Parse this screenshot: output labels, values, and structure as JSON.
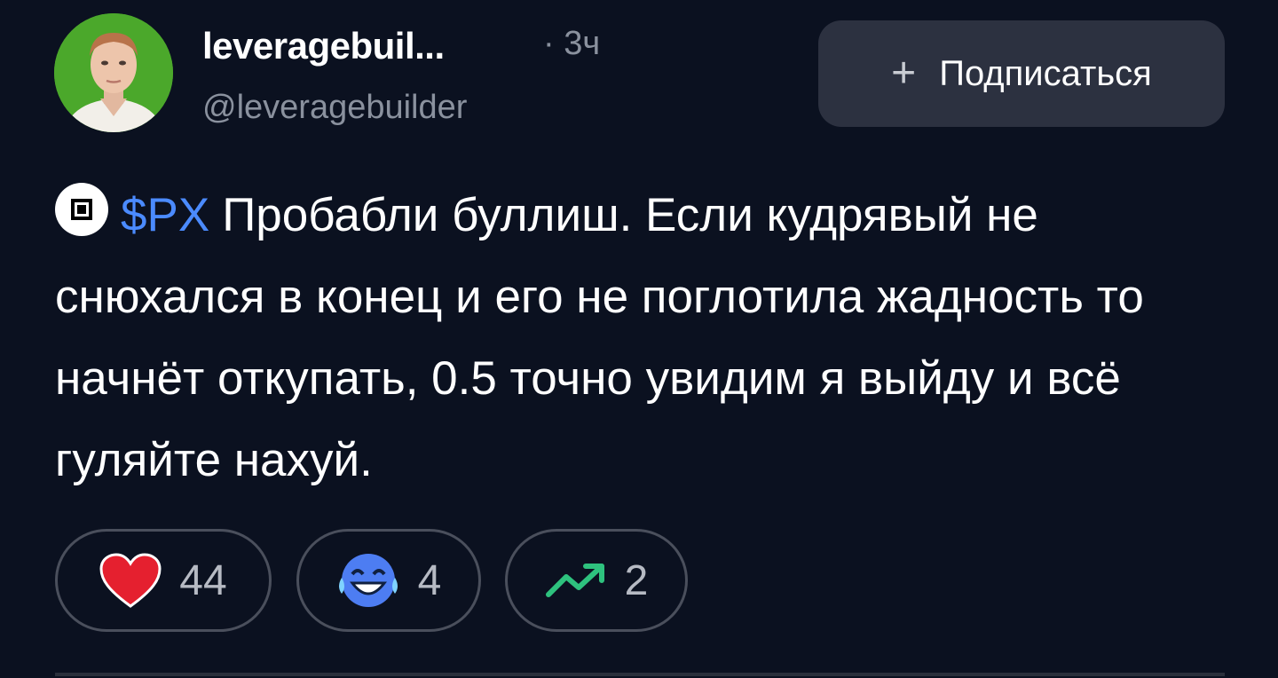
{
  "post": {
    "author": {
      "name": "leveragebuil...",
      "handle": "@leveragebuilder",
      "time": "· 3ч"
    },
    "follow_button": {
      "icon": "plus-icon",
      "label": "Подписаться"
    },
    "ticker": {
      "icon": "square-logo-icon",
      "symbol": "$PX"
    },
    "text": "Пробабли буллиш. Если кудрявый не снюхался в конец и его не поглотила жадность то начнёт откупать, 0.5 точно увидим я выйду и всё гуляйте нахуй.",
    "reactions": [
      {
        "icon": "heart-icon",
        "count": "44"
      },
      {
        "icon": "laughing-emoji-icon",
        "count": "4"
      },
      {
        "icon": "trend-up-icon",
        "count": "2"
      }
    ]
  },
  "colors": {
    "background": "#0b1120",
    "link": "#4b8bff",
    "muted": "#8a919e",
    "button_bg": "#2c3140",
    "heart": "#e5202f",
    "trend": "#2ec27e"
  }
}
